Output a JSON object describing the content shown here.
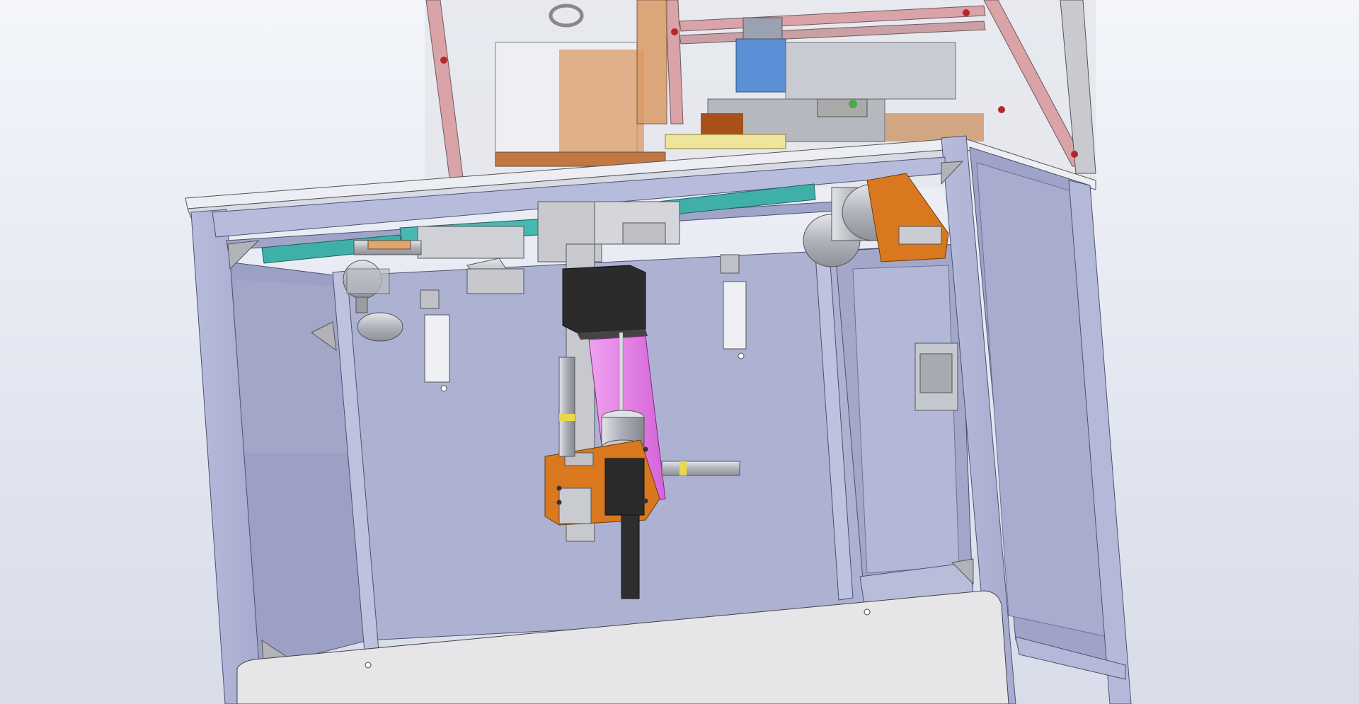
{
  "viewport": {
    "background_top": "#f4f6fb",
    "background_bottom": "#d9dde9"
  },
  "model": {
    "colors": {
      "frame": "#b3b8d8",
      "frame_dark": "#8f94b8",
      "panel": "#a9aed0",
      "panel_light": "#c3c7e1",
      "upper_frame": "#d8a4a8",
      "glass": "#e7e9ef",
      "teal": "#3fb0a8",
      "orange": "#d9781e",
      "magenta": "#e37ee5",
      "black": "#2b2b2b",
      "blue": "#5b8fd6",
      "brown": "#c17844",
      "steel": "#b9bcc4",
      "plate": "#e6e6e8",
      "yellow": "#e8d84a"
    }
  }
}
